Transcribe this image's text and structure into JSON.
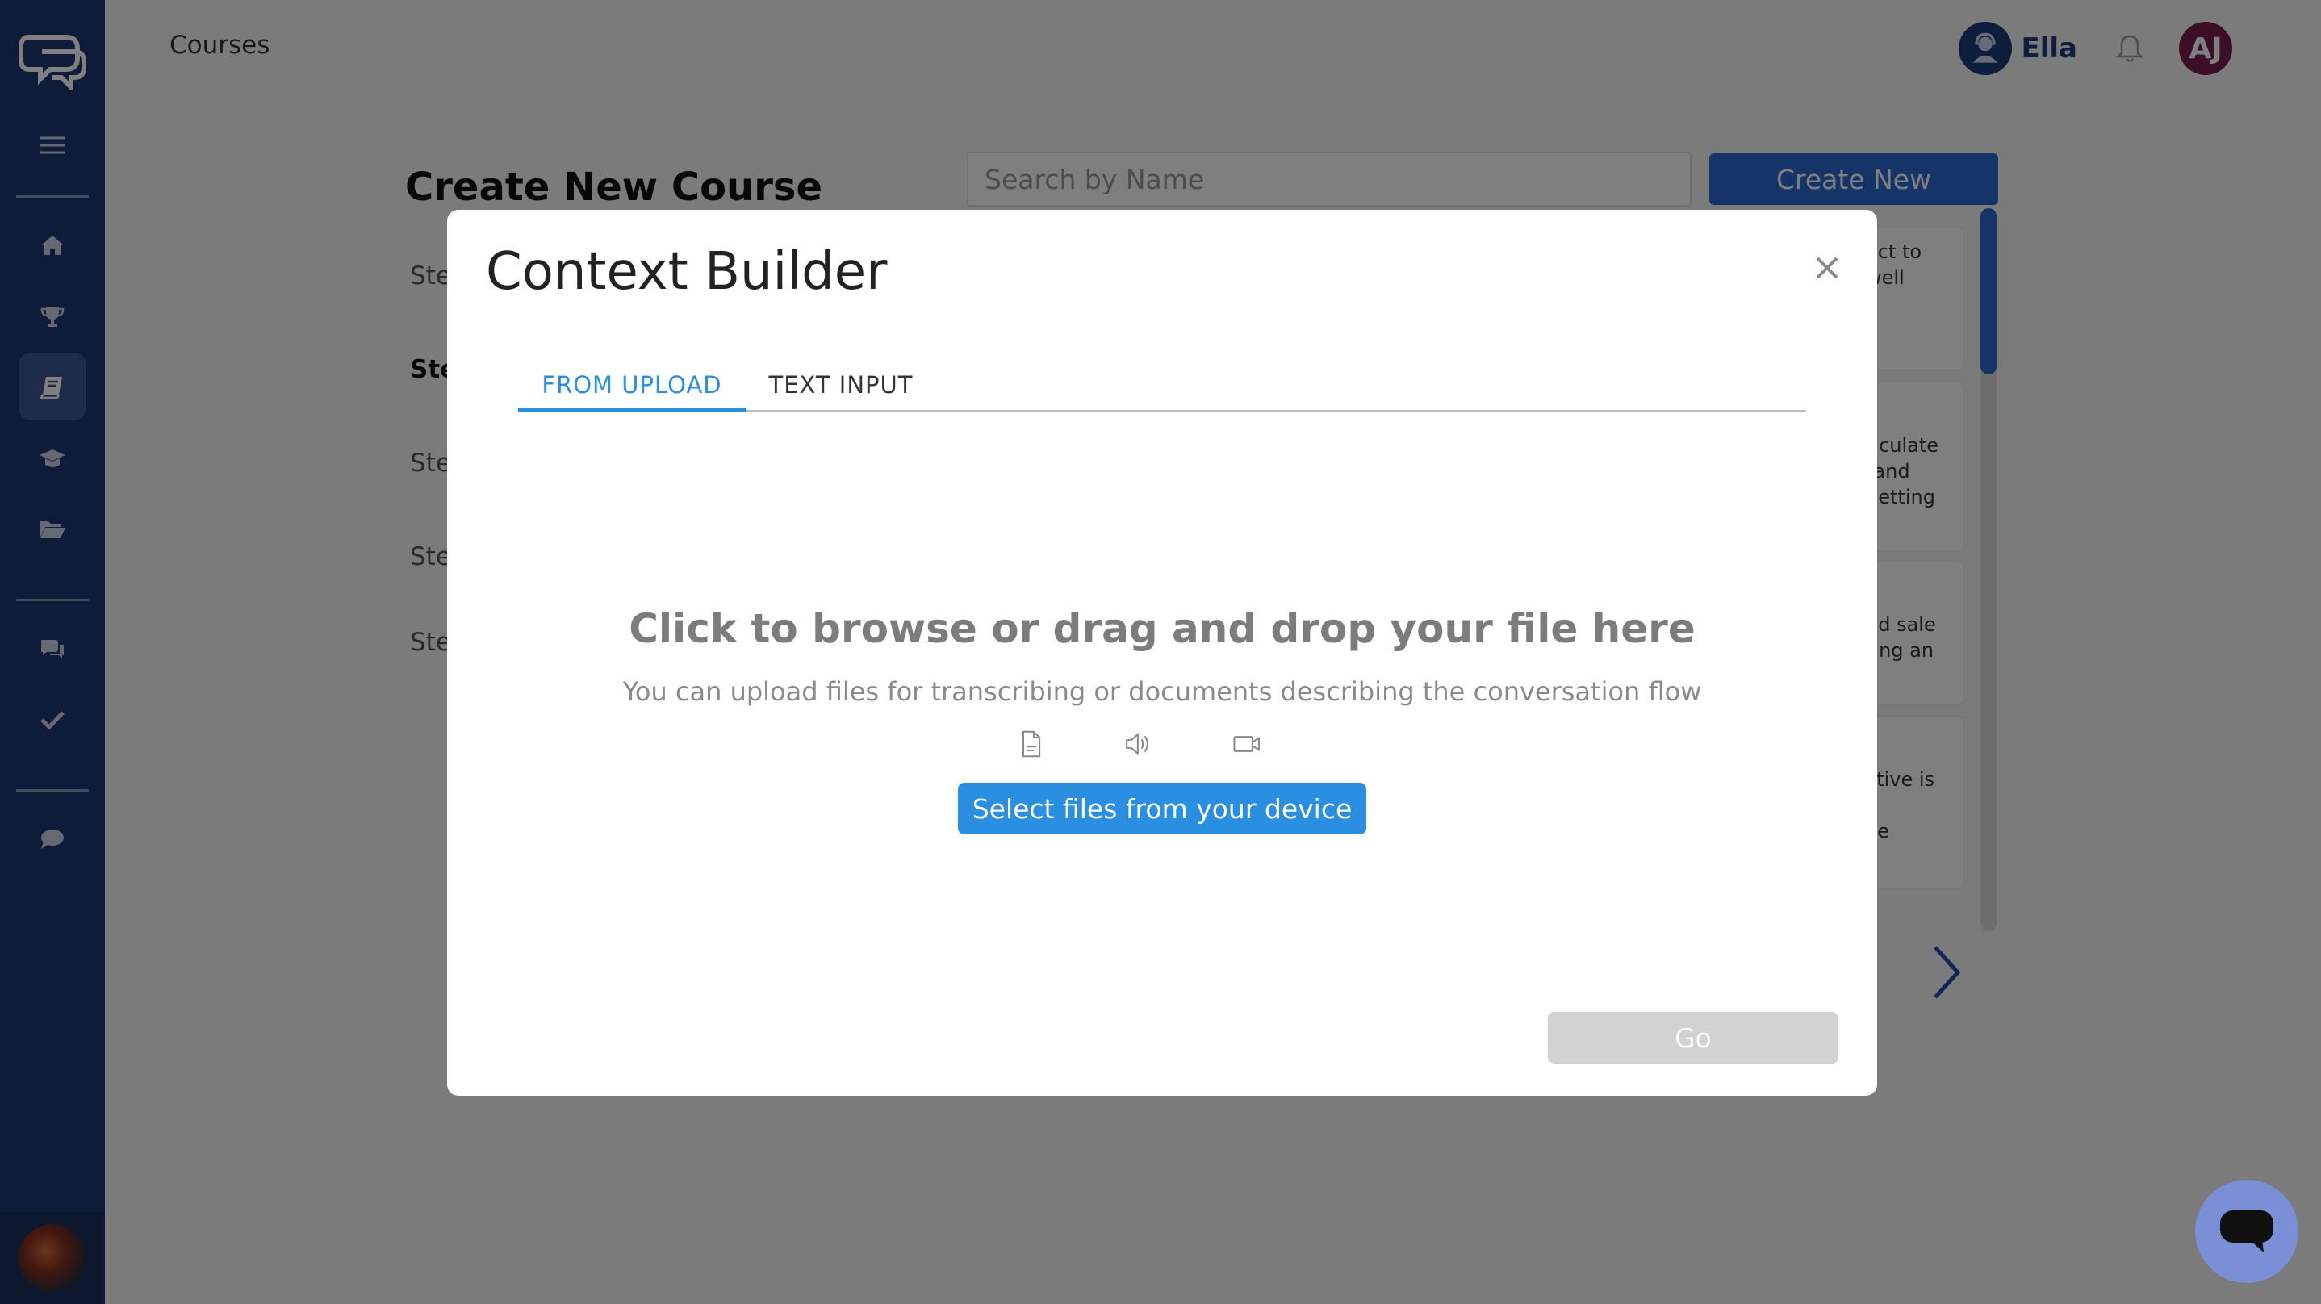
{
  "header": {
    "page_title": "Courses",
    "assistant_name": "Ella",
    "user_initials": "AJ"
  },
  "background": {
    "heading": "Create New Course",
    "search_placeholder": "Search by Name",
    "create_button": "Create New",
    "steps": [
      "Ste",
      "Ste",
      "Ste",
      "Ste",
      "Ste"
    ],
    "cards": [
      [
        "act to",
        "well"
      ],
      [
        "ticulate",
        "tand",
        "getting"
      ],
      [
        "nd sale",
        "ting an"
      ],
      [
        "ctive is",
        "",
        "ve"
      ]
    ]
  },
  "modal": {
    "title": "Context Builder",
    "tabs": [
      "FROM UPLOAD",
      "TEXT INPUT"
    ],
    "active_tab": "FROM UPLOAD",
    "drop_title": "Click to browse or drag and drop your file here",
    "drop_subtitle": "You can upload files for transcribing or documents describing the conversation flow",
    "file_type_icons": [
      "document-icon",
      "audio-icon",
      "video-icon"
    ],
    "select_button": "Select files from your device",
    "go_button": "Go"
  },
  "colors": {
    "sidebar": "#1d3972",
    "primary": "#2a8fe0",
    "create_button": "#2a6bd1",
    "user_avatar": "#7b1e4f",
    "disabled": "#d2d2d2"
  }
}
